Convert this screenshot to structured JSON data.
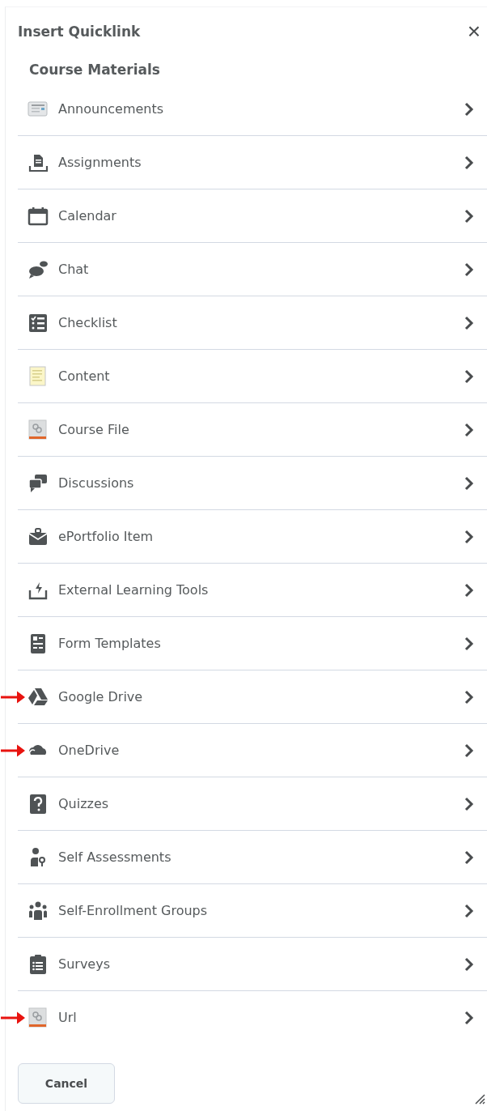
{
  "dialog": {
    "title": "Insert Quicklink",
    "close": "×"
  },
  "section": {
    "title": "Course Materials"
  },
  "items": [
    {
      "label": "Announcements",
      "kind": "news",
      "highlighted": false
    },
    {
      "label": "Assignments",
      "kind": "dropbox",
      "highlighted": false
    },
    {
      "label": "Calendar",
      "kind": "calendar",
      "highlighted": false
    },
    {
      "label": "Chat",
      "kind": "chat",
      "highlighted": false
    },
    {
      "label": "Checklist",
      "kind": "checklist",
      "highlighted": false
    },
    {
      "label": "Content",
      "kind": "page",
      "highlighted": false
    },
    {
      "label": "Course File",
      "kind": "link",
      "highlighted": false
    },
    {
      "label": "Discussions",
      "kind": "discuss",
      "highlighted": false
    },
    {
      "label": "ePortfolio Item",
      "kind": "briefcase",
      "highlighted": false
    },
    {
      "label": "External Learning Tools",
      "kind": "tray",
      "highlighted": false
    },
    {
      "label": "Form Templates",
      "kind": "form",
      "highlighted": false
    },
    {
      "label": "Google Drive",
      "kind": "triangle",
      "highlighted": true
    },
    {
      "label": "OneDrive",
      "kind": "cloud",
      "highlighted": true
    },
    {
      "label": "Quizzes",
      "kind": "question",
      "highlighted": false
    },
    {
      "label": "Self Assessments",
      "kind": "person",
      "highlighted": false
    },
    {
      "label": "Self-Enrollment Groups",
      "kind": "group",
      "highlighted": false
    },
    {
      "label": "Surveys",
      "kind": "clipboard",
      "highlighted": false
    },
    {
      "label": "Url",
      "kind": "link",
      "highlighted": true
    }
  ],
  "buttons": [
    {
      "label": "Cancel"
    }
  ]
}
